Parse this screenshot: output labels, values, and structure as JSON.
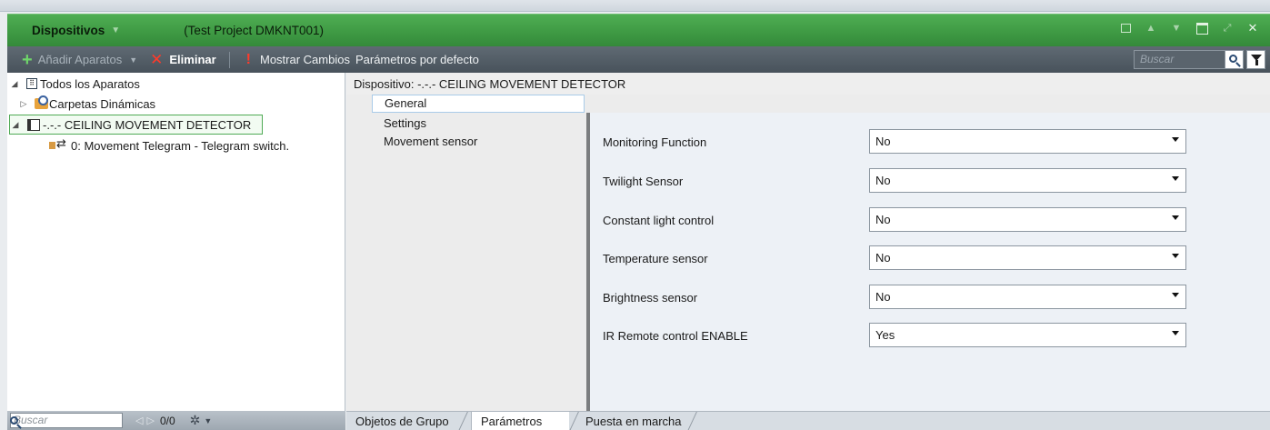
{
  "titlebar": {
    "panel_name": "Dispositivos",
    "project_name": "(Test Project DMKNT001)"
  },
  "toolbar": {
    "add_label": "Añadir Aparatos",
    "delete_label": "Eliminar",
    "show_changes_label": "Mostrar Cambios",
    "defaults_label": "Parámetros por defecto",
    "search_placeholder": "Buscar"
  },
  "tree": {
    "items": [
      {
        "label": "Todos los Aparatos"
      },
      {
        "label": "Carpetas Dinámicas"
      },
      {
        "label": "-.-.-  CEILING MOVEMENT DETECTOR"
      },
      {
        "label": "0: Movement Telegram - Telegram switch."
      }
    ]
  },
  "left_status": {
    "search_placeholder": "Buscar",
    "count": "0/0"
  },
  "device": {
    "header": "Dispositivo: -.-.-  CEILING MOVEMENT DETECTOR"
  },
  "nav": {
    "items": [
      {
        "label": "General",
        "active": true
      },
      {
        "label": "Settings",
        "active": false
      },
      {
        "label": "Movement sensor",
        "active": false
      }
    ]
  },
  "params": [
    {
      "label": "Monitoring Function",
      "value": "No"
    },
    {
      "label": "Twilight Sensor",
      "value": "No"
    },
    {
      "label": "Constant light control",
      "value": "No"
    },
    {
      "label": "Temperature sensor",
      "value": "No"
    },
    {
      "label": "Brightness sensor",
      "value": "No"
    },
    {
      "label": "IR Remote control ENABLE",
      "value": "Yes"
    }
  ],
  "bottom_tabs": [
    {
      "label": "Objetos de Grupo",
      "active": false
    },
    {
      "label": "Parámetros",
      "active": true
    },
    {
      "label": "Puesta en marcha",
      "active": false
    }
  ],
  "colors": {
    "titlebar_green": "#3f9a44",
    "toolbar_gray": "#48525b",
    "selection_green": "#4faa55"
  }
}
